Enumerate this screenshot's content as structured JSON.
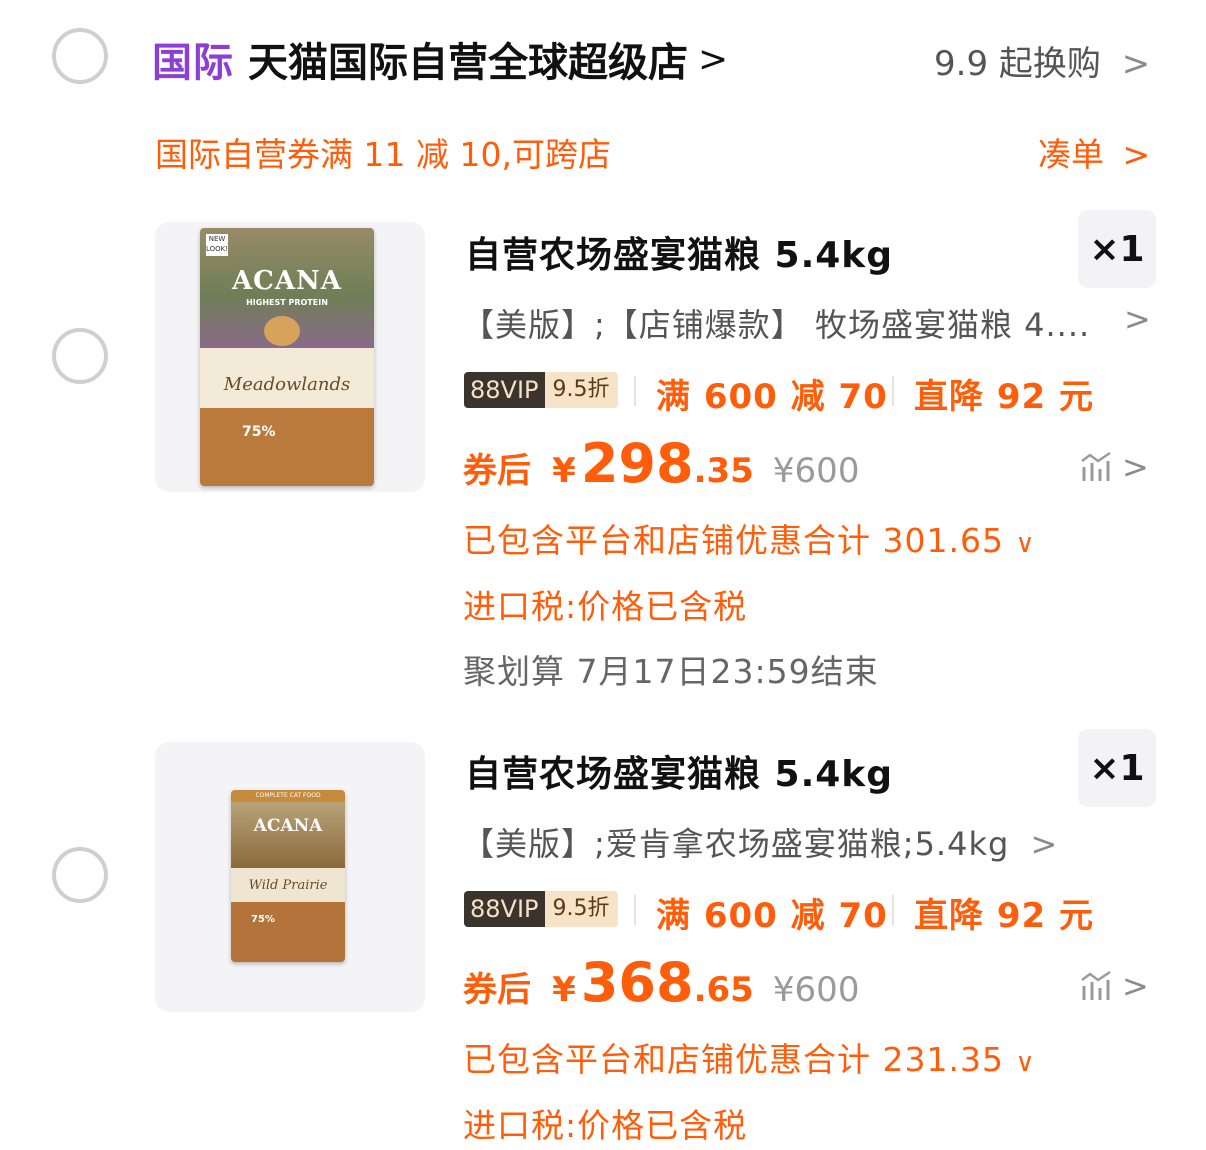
{
  "store": {
    "badge": "国际",
    "name": "天猫国际自营全球超级店",
    "name_chevron": ">",
    "right_action": "9.9 起换购",
    "right_chevron": ">"
  },
  "coupon_bar": {
    "text": "国际自营券满 11 减 10,可跨店",
    "action": "凑单",
    "chevron": ">"
  },
  "items": [
    {
      "title": "自营农场盛宴猫粮 5.4kg",
      "quantity": "×1",
      "spec": "【美版】;【店铺爆款】 牧场盛宴猫粮 4....",
      "spec_chevron": ">",
      "vip_label": "88VIP",
      "vip_discount": "9.5折",
      "promo_1": "满 600 减 70",
      "promo_2": "直降 92 元",
      "price_prefix": "券后",
      "currency": "¥",
      "price_int": "298",
      "price_dec": ".35",
      "original_price": "¥600",
      "discount_total": "已包含平台和店铺优惠合计 301.65",
      "discount_chevron": "∨",
      "tax": "进口税:价格已含税",
      "event": "聚划算 7月17日23:59结束",
      "product_brand": "ACANA",
      "product_variant": "Meadowlands",
      "product_tag": "HIGHEST PROTEIN",
      "product_percent": "75%"
    },
    {
      "title": "自营农场盛宴猫粮 5.4kg",
      "quantity": "×1",
      "spec": "【美版】;爱肯拿农场盛宴猫粮;5.4kg",
      "spec_chevron": ">",
      "vip_label": "88VIP",
      "vip_discount": "9.5折",
      "promo_1": "满 600 减 70",
      "promo_2": "直降 92 元",
      "price_prefix": "券后",
      "currency": "¥",
      "price_int": "368",
      "price_dec": ".65",
      "original_price": "¥600",
      "discount_total": "已包含平台和店铺优惠合计 231.35",
      "discount_chevron": "∨",
      "tax": "进口税:价格已含税",
      "product_brand": "ACANA",
      "product_variant": "Wild Prairie",
      "product_tag": "COMPLETE CAT FOOD",
      "product_percent": "75%"
    }
  ],
  "colors": {
    "accent": "#ff5d0a",
    "store_badge": "#8b3fd6",
    "vip_dark": "#3a332e",
    "vip_light": "#f7e3c7"
  }
}
